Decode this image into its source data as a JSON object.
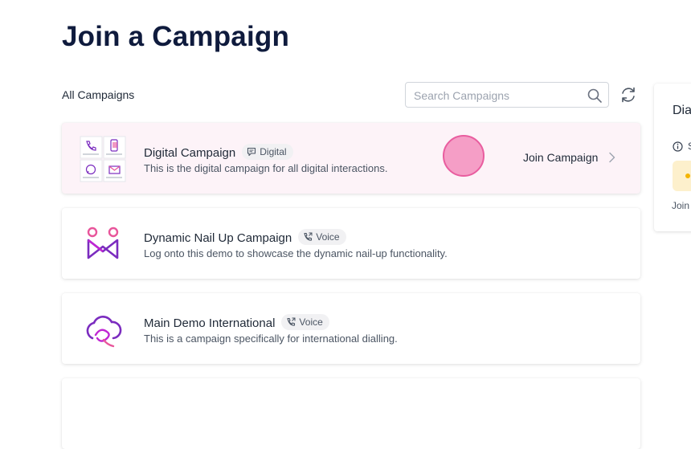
{
  "page": {
    "title": "Join a Campaign"
  },
  "toolbar": {
    "section_label": "All Campaigns",
    "search_placeholder": "Search Campaigns",
    "search_value": ""
  },
  "campaigns": [
    {
      "name": "Digital Campaign",
      "type": "Digital",
      "type_icon": "chat-icon",
      "description": "This is the digital campaign for all digital interactions.",
      "selected": true,
      "action_label": "Join Campaign"
    },
    {
      "name": "Dynamic Nail Up Campaign",
      "type": "Voice",
      "type_icon": "phone-icon",
      "description": "Log onto this demo to showcase the dynamic nail-up functionality.",
      "selected": false
    },
    {
      "name": "Main Demo International",
      "type": "Voice",
      "type_icon": "phone-icon",
      "description": "This is a campaign specifically for international dialling.",
      "selected": false
    }
  ],
  "right_panel": {
    "title": "Dia",
    "info_text": "S",
    "join_text": "Join"
  },
  "colors": {
    "title": "#0f1b3d",
    "selected_card_bg": "#fdf3f8",
    "accent_pink": "#e8559b",
    "accent_purple": "#7b2cbf",
    "status_bg": "#fdf0cc",
    "status_dot": "#f4b400"
  }
}
